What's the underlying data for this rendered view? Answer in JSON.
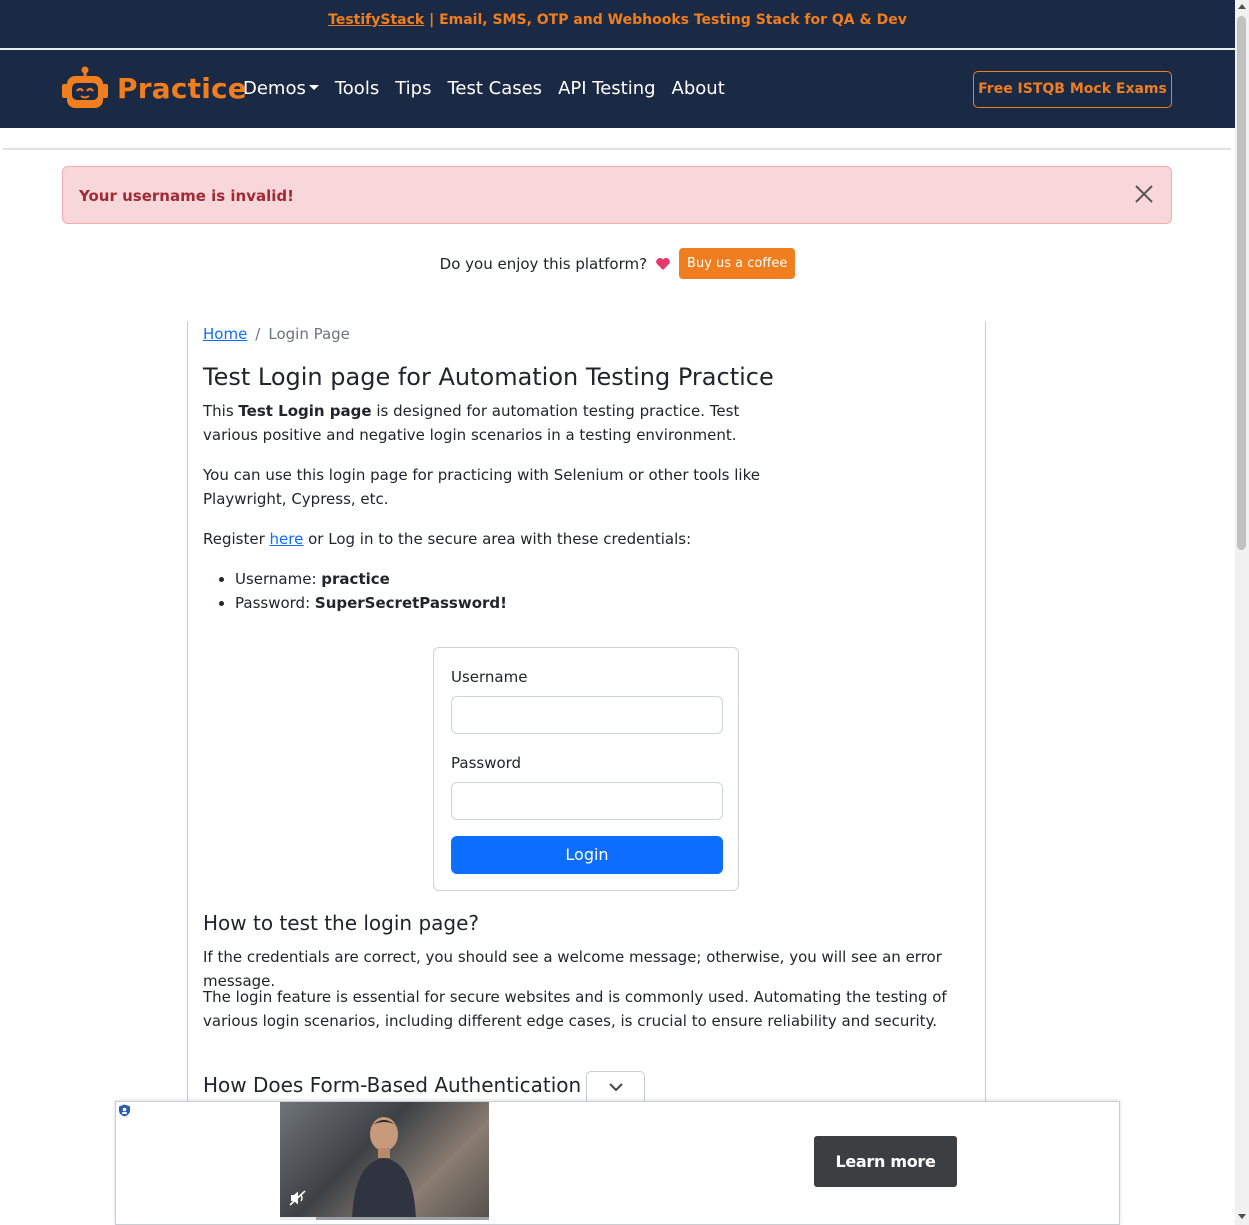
{
  "promo": {
    "link_text": "TestifyStack",
    "rest_text": " | Email, SMS, OTP and Webhooks Testing Stack for QA & Dev"
  },
  "navbar": {
    "brand": "Practice",
    "items": [
      {
        "label": "Demos",
        "dropdown": true
      },
      {
        "label": "Tools"
      },
      {
        "label": "Tips"
      },
      {
        "label": "Test Cases"
      },
      {
        "label": "API Testing"
      },
      {
        "label": "About"
      }
    ],
    "cta_label": "Free ISTQB Mock Exams"
  },
  "alert": {
    "message": "Your username is invalid!",
    "close_icon": "close-icon"
  },
  "support": {
    "question": "Do you enjoy this platform?",
    "button_label": "Buy us a coffee"
  },
  "breadcrumb": {
    "home": "Home",
    "separator": "/",
    "current": "Login Page"
  },
  "main": {
    "title": "Test Login page for Automation Testing Practice",
    "p1_a": "This ",
    "p1_b": "Test Login page",
    "p1_c": " is designed for automation testing practice. Test various positive and negative login scenarios in a testing environment.",
    "p2": "You can use this login page for practicing with Selenium or other tools like Playwright, Cypress, etc.",
    "p3_a": "Register ",
    "p3_link": "here",
    "p3_b": " or Log in to the secure area with these credentials:",
    "credentials": {
      "username_label": "Username: ",
      "username_value": "practice",
      "password_label": "Password: ",
      "password_value": "SuperSecretPassword!"
    }
  },
  "login_form": {
    "username_label": "Username",
    "username_value": "",
    "password_label": "Password",
    "password_value": "",
    "submit_label": "Login"
  },
  "section2": {
    "heading": "How to test the login page?",
    "p1": "If the credentials are correct, you should see a welcome message; otherwise, you will see an error message.",
    "p2": "The login feature is essential for secure websites and is commonly used. Automating the testing of various login scenarios, including different edge cases, is crucial to ensure reliability and security.",
    "heading2": "How Does Form-Based Authentication Wo"
  },
  "ad": {
    "cta_label": "Learn more",
    "progress": 0.17
  },
  "colors": {
    "navy": "#1b2a44",
    "orange": "#f07d1e",
    "primary": "#0d6efd",
    "alert_bg": "#f8d7da",
    "alert_text": "#a02a35"
  }
}
